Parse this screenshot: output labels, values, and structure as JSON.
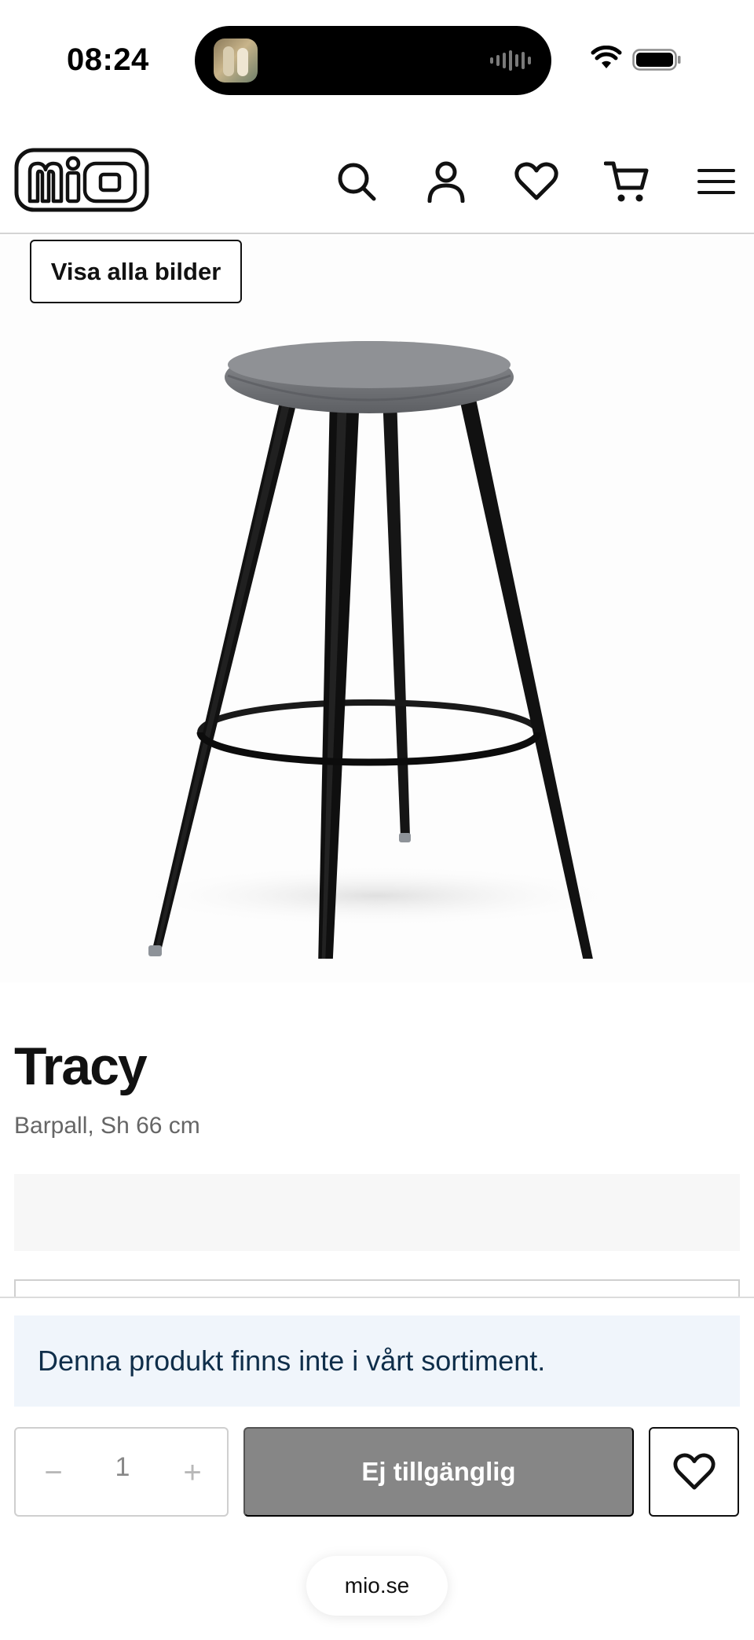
{
  "status_bar": {
    "time": "08:24"
  },
  "header": {
    "logo_text": "mio",
    "icons": [
      "search-icon",
      "account-icon",
      "heart-icon",
      "cart-icon",
      "menu-icon"
    ]
  },
  "gallery": {
    "show_all_label": "Visa alla bilder"
  },
  "product": {
    "name": "Tracy",
    "subtitle": "Barpall, Sh 66 cm"
  },
  "purchase_bar": {
    "notice": "Denna produkt finns inte i vårt sortiment.",
    "quantity": "1",
    "minus_symbol": "−",
    "plus_symbol": "+",
    "unavailable_label": "Ej tillgänglig"
  },
  "browser": {
    "url": "mio.se"
  },
  "colors": {
    "notice_bg": "#f0f5fb",
    "notice_text": "#0f2e4a",
    "disabled_button": "#868686",
    "text_muted": "#666666"
  }
}
